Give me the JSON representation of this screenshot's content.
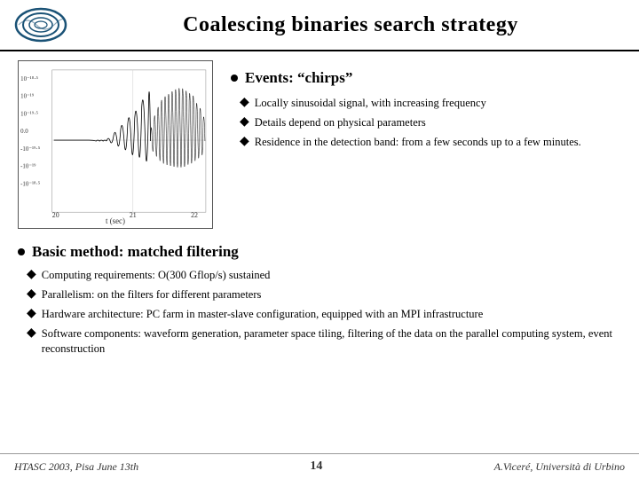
{
  "header": {
    "title": "Coalescing binaries search strategy"
  },
  "top": {
    "main_bullet": "Events: “chirps”",
    "sub_bullets": [
      "Locally sinusoidal signal, with increasing frequency",
      "Details depend on physical parameters",
      "Residence in the detection band: from a few seconds up to a few minutes."
    ]
  },
  "bottom": {
    "main_bullet": "Basic method: matched filtering",
    "sub_bullets": [
      "Computing requirements: O(300 Gflop/s) sustained",
      "Parallelism:  on the filters for different parameters",
      "Hardware architecture: PC farm in master-slave configuration, equipped with an MPI infrastructure",
      "Software components: waveform generation, parameter space tiling, filtering of the data on the parallel computing system, event reconstruction"
    ]
  },
  "footer": {
    "left": "HTASC 2003, Pisa June 13th",
    "center": "14",
    "right": "A.Viceré, Università di Urbino"
  },
  "icons": {
    "logo": "spiral-logo",
    "bullet_diamond": "◆"
  }
}
